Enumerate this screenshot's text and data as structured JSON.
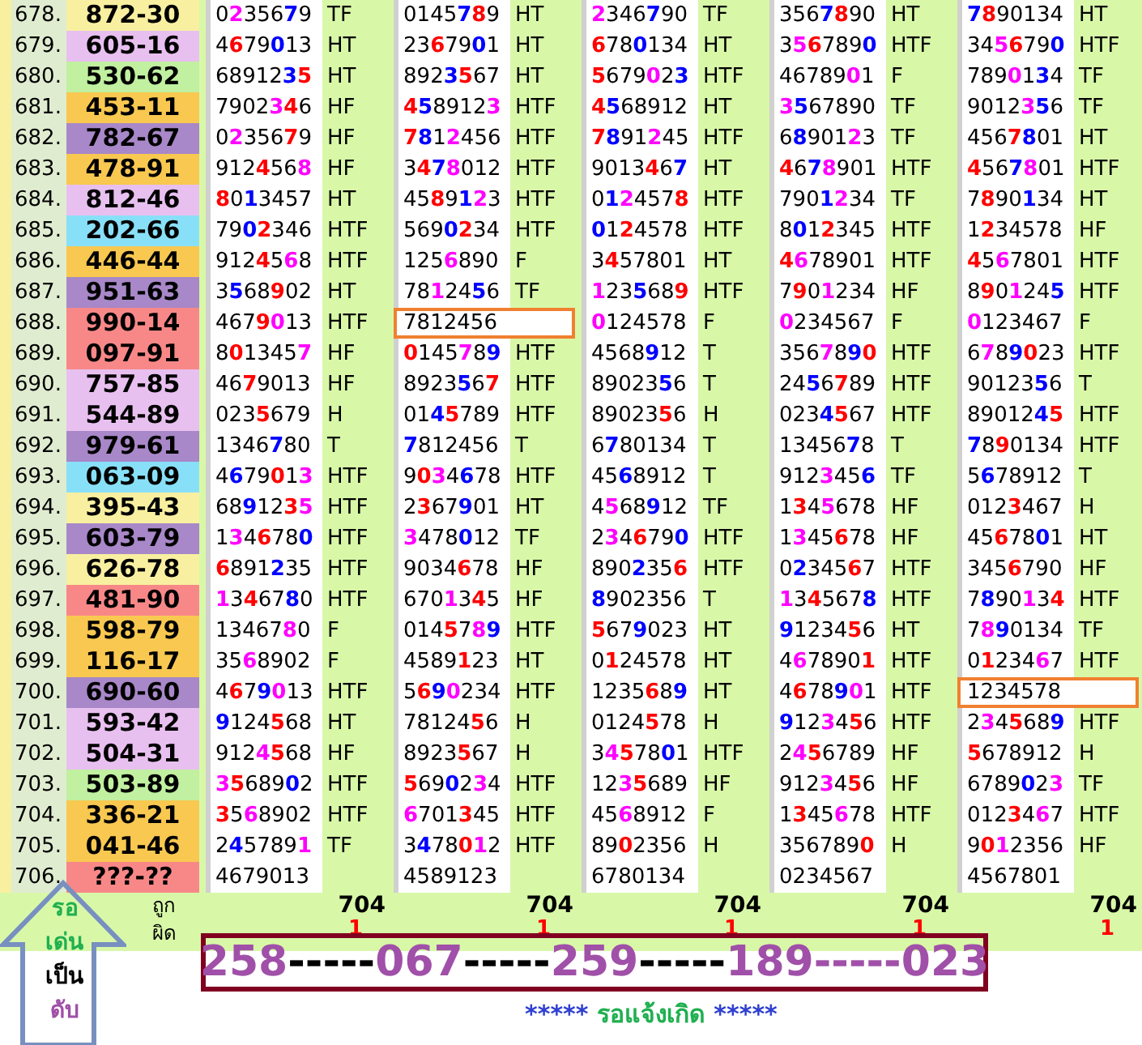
{
  "rows": [
    {
      "index": "678.",
      "result": "872-30",
      "color": "#f8f0a0",
      "groups": [
        {
          "digits": "0235679",
          "code": "TF",
          "outlined": false
        },
        {
          "digits": "0145789",
          "code": "HT",
          "outlined": false
        },
        {
          "digits": "2346790",
          "code": "TF",
          "outlined": false
        },
        {
          "digits": "3567890",
          "code": "HT",
          "outlined": false
        },
        {
          "digits": "7890134",
          "code": "HT",
          "outlined": false
        }
      ]
    },
    {
      "index": "679.",
      "result": "605-16",
      "color": "#e8c0f0",
      "groups": [
        {
          "digits": "4679013",
          "code": "HT",
          "outlined": false
        },
        {
          "digits": "2367901",
          "code": "HT",
          "outlined": false
        },
        {
          "digits": "6780134",
          "code": "HT",
          "outlined": false
        },
        {
          "digits": "3567890",
          "code": "HTF",
          "outlined": false
        },
        {
          "digits": "3456790",
          "code": "HTF",
          "outlined": false
        }
      ]
    },
    {
      "index": "680.",
      "result": "530-62",
      "color": "#c0f0a0",
      "groups": [
        {
          "digits": "6891235",
          "code": "HT",
          "outlined": false
        },
        {
          "digits": "8923567",
          "code": "HT",
          "outlined": false
        },
        {
          "digits": "5679023",
          "code": "HTF",
          "outlined": false
        },
        {
          "digits": "4678901",
          "code": "F",
          "outlined": false
        },
        {
          "digits": "7890134",
          "code": "TF",
          "outlined": false
        }
      ]
    },
    {
      "index": "681.",
      "result": "453-11",
      "color": "#f8c850",
      "groups": [
        {
          "digits": "7902346",
          "code": "HF",
          "outlined": false
        },
        {
          "digits": "4589123",
          "code": "HTF",
          "outlined": false
        },
        {
          "digits": "4568912",
          "code": "HT",
          "outlined": false
        },
        {
          "digits": "3567890",
          "code": "TF",
          "outlined": false
        },
        {
          "digits": "9012356",
          "code": "TF",
          "outlined": false
        }
      ]
    },
    {
      "index": "682.",
      "result": "782-67",
      "color": "#a888c8",
      "groups": [
        {
          "digits": "0235679",
          "code": "HF",
          "outlined": false
        },
        {
          "digits": "7812456",
          "code": "HTF",
          "outlined": false
        },
        {
          "digits": "7891245",
          "code": "HTF",
          "outlined": false
        },
        {
          "digits": "6890123",
          "code": "TF",
          "outlined": false
        },
        {
          "digits": "4567801",
          "code": "HT",
          "outlined": false
        }
      ]
    },
    {
      "index": "683.",
      "result": "478-91",
      "color": "#f8c850",
      "groups": [
        {
          "digits": "9124568",
          "code": "HF",
          "outlined": false
        },
        {
          "digits": "3478012",
          "code": "HTF",
          "outlined": false
        },
        {
          "digits": "9013467",
          "code": "HT",
          "outlined": false
        },
        {
          "digits": "4678901",
          "code": "HTF",
          "outlined": false
        },
        {
          "digits": "4567801",
          "code": "HTF",
          "outlined": false
        }
      ]
    },
    {
      "index": "684.",
      "result": "812-46",
      "color": "#e8c0f0",
      "groups": [
        {
          "digits": "8013457",
          "code": "HT",
          "outlined": false
        },
        {
          "digits": "4589123",
          "code": "HTF",
          "outlined": false
        },
        {
          "digits": "0124578",
          "code": "HTF",
          "outlined": false
        },
        {
          "digits": "7901234",
          "code": "TF",
          "outlined": false
        },
        {
          "digits": "7890134",
          "code": "HT",
          "outlined": false
        }
      ]
    },
    {
      "index": "685.",
      "result": "202-66",
      "color": "#88e0f8",
      "groups": [
        {
          "digits": "7902346",
          "code": "HTF",
          "outlined": false
        },
        {
          "digits": "5690234",
          "code": "HTF",
          "outlined": false
        },
        {
          "digits": "0124578",
          "code": "HTF",
          "outlined": false
        },
        {
          "digits": "8012345",
          "code": "HTF",
          "outlined": false
        },
        {
          "digits": "1234578",
          "code": "HF",
          "outlined": false
        }
      ]
    },
    {
      "index": "686.",
      "result": "446-44",
      "color": "#f8c850",
      "groups": [
        {
          "digits": "9124568",
          "code": "HTF",
          "outlined": false
        },
        {
          "digits": "1256890",
          "code": "F",
          "outlined": false
        },
        {
          "digits": "3457801",
          "code": "HT",
          "outlined": false
        },
        {
          "digits": "4678901",
          "code": "HTF",
          "outlined": false
        },
        {
          "digits": "4567801",
          "code": "HTF",
          "outlined": false
        }
      ]
    },
    {
      "index": "687.",
      "result": "951-63",
      "color": "#a888c8",
      "groups": [
        {
          "digits": "3568902",
          "code": "HT",
          "outlined": false
        },
        {
          "digits": "7812456",
          "code": "TF",
          "outlined": false
        },
        {
          "digits": "1235689",
          "code": "HTF",
          "outlined": false
        },
        {
          "digits": "7901234",
          "code": "HF",
          "outlined": false
        },
        {
          "digits": "8901245",
          "code": "HTF",
          "outlined": false
        }
      ]
    },
    {
      "index": "688.",
      "result": "990-14",
      "color": "#f88888",
      "groups": [
        {
          "digits": "4679013",
          "code": "HTF",
          "outlined": false
        },
        {
          "digits": "7812456",
          "outlined": true
        },
        {
          "digits": "0124578",
          "code": "F",
          "outlined": false
        },
        {
          "digits": "0234567",
          "code": "F",
          "outlined": false
        },
        {
          "digits": "0123467",
          "code": "F",
          "outlined": false
        }
      ]
    },
    {
      "index": "689.",
      "result": "097-91",
      "color": "#f88888",
      "groups": [
        {
          "digits": "8013457",
          "code": "HF",
          "outlined": false
        },
        {
          "digits": "0145789",
          "code": "HTF",
          "outlined": false
        },
        {
          "digits": "4568912",
          "code": "T",
          "outlined": false
        },
        {
          "digits": "3567890",
          "code": "HTF",
          "outlined": false
        },
        {
          "digits": "6789023",
          "code": "HTF",
          "outlined": false
        }
      ]
    },
    {
      "index": "690.",
      "result": "757-85",
      "color": "#e8c0f0",
      "groups": [
        {
          "digits": "4679013",
          "code": "HF",
          "outlined": false
        },
        {
          "digits": "8923567",
          "code": "HTF",
          "outlined": false
        },
        {
          "digits": "8902356",
          "code": "T",
          "outlined": false
        },
        {
          "digits": "2456789",
          "code": "HTF",
          "outlined": false
        },
        {
          "digits": "9012356",
          "code": "T",
          "outlined": false
        }
      ]
    },
    {
      "index": "691.",
      "result": "544-89",
      "color": "#e8c0f0",
      "groups": [
        {
          "digits": "0235679",
          "code": "H",
          "outlined": false
        },
        {
          "digits": "0145789",
          "code": "HTF",
          "outlined": false
        },
        {
          "digits": "8902356",
          "code": "H",
          "outlined": false
        },
        {
          "digits": "0234567",
          "code": "HTF",
          "outlined": false
        },
        {
          "digits": "8901245",
          "code": "HTF",
          "outlined": false
        }
      ]
    },
    {
      "index": "692.",
      "result": "979-61",
      "color": "#a888c8",
      "groups": [
        {
          "digits": "1346780",
          "code": "T",
          "outlined": false
        },
        {
          "digits": "7812456",
          "code": "T",
          "outlined": false
        },
        {
          "digits": "6780134",
          "code": "T",
          "outlined": false
        },
        {
          "digits": "1345678",
          "code": "T",
          "outlined": false
        },
        {
          "digits": "7890134",
          "code": "HTF",
          "outlined": false
        }
      ]
    },
    {
      "index": "693.",
      "result": "063-09",
      "color": "#88e0f8",
      "groups": [
        {
          "digits": "4679013",
          "code": "HTF",
          "outlined": false
        },
        {
          "digits": "9034678",
          "code": "HTF",
          "outlined": false
        },
        {
          "digits": "4568912",
          "code": "T",
          "outlined": false
        },
        {
          "digits": "9123456",
          "code": "TF",
          "outlined": false
        },
        {
          "digits": "5678912",
          "code": "T",
          "outlined": false
        }
      ]
    },
    {
      "index": "694.",
      "result": "395-43",
      "color": "#f8f0a0",
      "groups": [
        {
          "digits": "6891235",
          "code": "HTF",
          "outlined": false
        },
        {
          "digits": "2367901",
          "code": "HT",
          "outlined": false
        },
        {
          "digits": "4568912",
          "code": "TF",
          "outlined": false
        },
        {
          "digits": "1345678",
          "code": "HF",
          "outlined": false
        },
        {
          "digits": "0123467",
          "code": "H",
          "outlined": false
        }
      ]
    },
    {
      "index": "695.",
      "result": "603-79",
      "color": "#a888c8",
      "groups": [
        {
          "digits": "1346780",
          "code": "HTF",
          "outlined": false
        },
        {
          "digits": "3478012",
          "code": "TF",
          "outlined": false
        },
        {
          "digits": "2346790",
          "code": "HTF",
          "outlined": false
        },
        {
          "digits": "1345678",
          "code": "HF",
          "outlined": false
        },
        {
          "digits": "4567801",
          "code": "HT",
          "outlined": false
        }
      ]
    },
    {
      "index": "696.",
      "result": "626-78",
      "color": "#f8f0a0",
      "groups": [
        {
          "digits": "6891235",
          "code": "HTF",
          "outlined": false
        },
        {
          "digits": "9034678",
          "code": "HF",
          "outlined": false
        },
        {
          "digits": "8902356",
          "code": "HTF",
          "outlined": false
        },
        {
          "digits": "0234567",
          "code": "HTF",
          "outlined": false
        },
        {
          "digits": "3456790",
          "code": "HF",
          "outlined": false
        }
      ]
    },
    {
      "index": "697.",
      "result": "481-90",
      "color": "#f88888",
      "groups": [
        {
          "digits": "1346780",
          "code": "HTF",
          "outlined": false
        },
        {
          "digits": "6701345",
          "code": "HF",
          "outlined": false
        },
        {
          "digits": "8902356",
          "code": "T",
          "outlined": false
        },
        {
          "digits": "1345678",
          "code": "HTF",
          "outlined": false
        },
        {
          "digits": "7890134",
          "code": "HTF",
          "outlined": false
        }
      ]
    },
    {
      "index": "698.",
      "result": "598-79",
      "color": "#f8c850",
      "groups": [
        {
          "digits": "1346780",
          "code": "F",
          "outlined": false
        },
        {
          "digits": "0145789",
          "code": "HTF",
          "outlined": false
        },
        {
          "digits": "5679023",
          "code": "HT",
          "outlined": false
        },
        {
          "digits": "9123456",
          "code": "HT",
          "outlined": false
        },
        {
          "digits": "7890134",
          "code": "TF",
          "outlined": false
        }
      ]
    },
    {
      "index": "699.",
      "result": "116-17",
      "color": "#f8c850",
      "groups": [
        {
          "digits": "3568902",
          "code": "F",
          "outlined": false
        },
        {
          "digits": "4589123",
          "code": "HT",
          "outlined": false
        },
        {
          "digits": "0124578",
          "code": "HT",
          "outlined": false
        },
        {
          "digits": "4678901",
          "code": "HTF",
          "outlined": false
        },
        {
          "digits": "0123467",
          "code": "HTF",
          "outlined": false
        }
      ]
    },
    {
      "index": "700.",
      "result": "690-60",
      "color": "#a888c8",
      "groups": [
        {
          "digits": "4679013",
          "code": "HTF",
          "outlined": false
        },
        {
          "digits": "5690234",
          "code": "HTF",
          "outlined": false
        },
        {
          "digits": "1235689",
          "code": "HT",
          "outlined": false
        },
        {
          "digits": "4678901",
          "code": "HTF",
          "outlined": false
        },
        {
          "digits": "1234578",
          "outlined": true
        }
      ]
    },
    {
      "index": "701.",
      "result": "593-42",
      "color": "#e8c0f0",
      "groups": [
        {
          "digits": "9124568",
          "code": "HT",
          "outlined": false
        },
        {
          "digits": "7812456",
          "code": "H",
          "outlined": false
        },
        {
          "digits": "0124578",
          "code": "H",
          "outlined": false
        },
        {
          "digits": "9123456",
          "code": "HTF",
          "outlined": false
        },
        {
          "digits": "2345689",
          "code": "HTF",
          "outlined": false
        }
      ]
    },
    {
      "index": "702.",
      "result": "504-31",
      "color": "#e8c0f0",
      "groups": [
        {
          "digits": "9124568",
          "code": "HF",
          "outlined": false
        },
        {
          "digits": "8923567",
          "code": "H",
          "outlined": false
        },
        {
          "digits": "3457801",
          "code": "HTF",
          "outlined": false
        },
        {
          "digits": "2456789",
          "code": "HF",
          "outlined": false
        },
        {
          "digits": "5678912",
          "code": "H",
          "outlined": false
        }
      ]
    },
    {
      "index": "703.",
      "result": "503-89",
      "color": "#c0f0a0",
      "groups": [
        {
          "digits": "3568902",
          "code": "HTF",
          "outlined": false
        },
        {
          "digits": "5690234",
          "code": "HTF",
          "outlined": false
        },
        {
          "digits": "1235689",
          "code": "HF",
          "outlined": false
        },
        {
          "digits": "9123456",
          "code": "HF",
          "outlined": false
        },
        {
          "digits": "6789023",
          "code": "TF",
          "outlined": false
        }
      ]
    },
    {
      "index": "704.",
      "result": "336-21",
      "color": "#f8c850",
      "groups": [
        {
          "digits": "3568902",
          "code": "HTF",
          "outlined": false
        },
        {
          "digits": "6701345",
          "code": "HTF",
          "outlined": false
        },
        {
          "digits": "4568912",
          "code": "F",
          "outlined": false
        },
        {
          "digits": "1345678",
          "code": "HTF",
          "outlined": false
        },
        {
          "digits": "0123467",
          "code": "HTF",
          "outlined": false
        }
      ]
    },
    {
      "index": "705.",
      "result": "041-46",
      "color": "#f8c850",
      "groups": [
        {
          "digits": "2457891",
          "code": "TF",
          "outlined": false
        },
        {
          "digits": "3478012",
          "code": "HTF",
          "outlined": false
        },
        {
          "digits": "8902356",
          "code": "H",
          "outlined": false
        },
        {
          "digits": "3567890",
          "code": "H",
          "outlined": false
        },
        {
          "digits": "9012356",
          "code": "HF",
          "outlined": false
        }
      ]
    },
    {
      "index": "706.",
      "result": "???-??",
      "color": "#f88888",
      "groups": [
        {
          "digits": "4679013",
          "outlined": false
        },
        {
          "digits": "4589123",
          "outlined": false
        },
        {
          "digits": "6780134",
          "outlined": false
        },
        {
          "digits": "0234567",
          "outlined": false
        },
        {
          "digits": "4567801",
          "outlined": false
        }
      ]
    }
  ],
  "footer": {
    "arrow_labels": [
      {
        "text": "รอ",
        "color": "#20b050"
      },
      {
        "text": "เด่น",
        "color": "#20b050"
      },
      {
        "text": "เป็น",
        "color": "#000000"
      },
      {
        "text": "ดับ",
        "color": "#a050a8"
      }
    ],
    "labels": [
      "ถูก",
      "ผิด"
    ],
    "tallies": [
      {
        "correct": "704",
        "wrong": "1"
      },
      {
        "correct": "704",
        "wrong": "1"
      },
      {
        "correct": "704",
        "wrong": "1"
      },
      {
        "correct": "704",
        "wrong": "1"
      },
      {
        "correct": "704",
        "wrong": "1"
      }
    ],
    "sequence": [
      {
        "text": "258",
        "color": "#a050a8"
      },
      {
        "text": "-----",
        "color": "#000000"
      },
      {
        "text": "067",
        "color": "#a050a8"
      },
      {
        "text": "-----",
        "color": "#000000"
      },
      {
        "text": "259",
        "color": "#a050a8"
      },
      {
        "text": "-----",
        "color": "#000000"
      },
      {
        "text": "189",
        "color": "#a050a8"
      },
      {
        "text": "-----",
        "color": "#a050a8"
      },
      {
        "text": "023",
        "color": "#a050a8"
      }
    ],
    "notice": [
      {
        "text": "***** ",
        "color": "#3040d0"
      },
      {
        "text": "รอแจ้งเกิด",
        "color": "#20b050"
      },
      {
        "text": " *****",
        "color": "#3040d0"
      }
    ]
  }
}
